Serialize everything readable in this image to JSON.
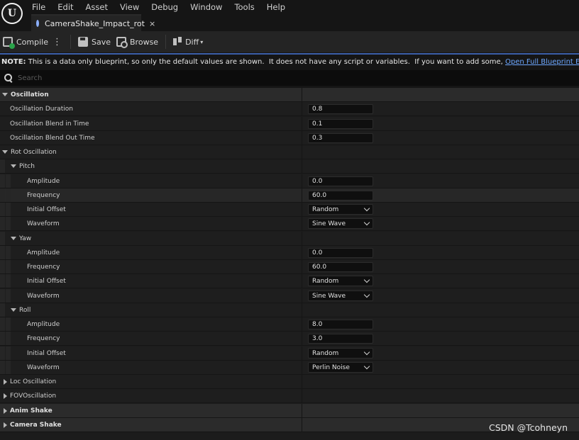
{
  "app": {
    "logo_letter": "U",
    "menu": [
      "File",
      "Edit",
      "Asset",
      "View",
      "Debug",
      "Window",
      "Tools",
      "Help"
    ],
    "tab_title": "CameraShake_Impact_rot",
    "tab_close": "×"
  },
  "toolbar": {
    "compile_label": "Compile",
    "more": "⋮",
    "save_label": "Save",
    "browse_label": "Browse",
    "diff_label": "Diff",
    "diff_caret": "▾"
  },
  "note": {
    "bold": "NOTE:",
    "text": " This is a data only blueprint, so only the default values are shown.  It does not have any script or variables.  If you want to add some, ",
    "link": "Open Full Blueprint Editor"
  },
  "search": {
    "placeholder": "Search"
  },
  "details": {
    "rows": [
      {
        "label": "Oscillation",
        "kind": "category",
        "arrow": "down",
        "depth": 0
      },
      {
        "label": "Oscillation Duration",
        "kind": "number",
        "value": "0.8",
        "depth": 1
      },
      {
        "label": "Oscillation Blend in Time",
        "kind": "number",
        "value": "0.1",
        "depth": 1
      },
      {
        "label": "Oscillation Blend Out Time",
        "kind": "number",
        "value": "0.3",
        "depth": 1
      },
      {
        "label": "Rot Oscillation",
        "kind": "group",
        "arrow": "down",
        "depth": 1
      },
      {
        "label": "Pitch",
        "kind": "group",
        "arrow": "down",
        "depth": 2
      },
      {
        "label": "Amplitude",
        "kind": "number",
        "value": "0.0",
        "depth": 3
      },
      {
        "label": "Frequency",
        "kind": "number",
        "value": "60.0",
        "depth": 3,
        "hover": true
      },
      {
        "label": "Initial Offset",
        "kind": "dropdown",
        "value": "Random",
        "depth": 3
      },
      {
        "label": "Waveform",
        "kind": "dropdown",
        "value": "Sine Wave",
        "depth": 3
      },
      {
        "label": "Yaw",
        "kind": "group",
        "arrow": "down",
        "depth": 2
      },
      {
        "label": "Amplitude",
        "kind": "number",
        "value": "0.0",
        "depth": 3
      },
      {
        "label": "Frequency",
        "kind": "number",
        "value": "60.0",
        "depth": 3
      },
      {
        "label": "Initial Offset",
        "kind": "dropdown",
        "value": "Random",
        "depth": 3
      },
      {
        "label": "Waveform",
        "kind": "dropdown",
        "value": "Sine Wave",
        "depth": 3
      },
      {
        "label": "Roll",
        "kind": "group",
        "arrow": "down",
        "depth": 2
      },
      {
        "label": "Amplitude",
        "kind": "number",
        "value": "8.0",
        "depth": 3
      },
      {
        "label": "Frequency",
        "kind": "number",
        "value": "3.0",
        "depth": 3
      },
      {
        "label": "Initial Offset",
        "kind": "dropdown",
        "value": "Random",
        "depth": 3
      },
      {
        "label": "Waveform",
        "kind": "dropdown",
        "value": "Perlin Noise",
        "depth": 3
      },
      {
        "label": "Loc Oscillation",
        "kind": "group",
        "arrow": "right",
        "depth": 1
      },
      {
        "label": "FOVOscillation",
        "kind": "group",
        "arrow": "right",
        "depth": 1
      },
      {
        "label": "Anim Shake",
        "kind": "category",
        "arrow": "right",
        "depth": 0
      },
      {
        "label": "Camera Shake",
        "kind": "category",
        "arrow": "right",
        "depth": 0
      }
    ]
  },
  "watermark": "CSDN @Tcohneyn",
  "colors": {
    "accent_link": "#6da7ff",
    "note_border": "#3b5ea8",
    "compile_ok": "#2aa34a"
  },
  "icons": [
    "unreal-logo-icon",
    "blueprint-icon",
    "compile-icon",
    "save-icon",
    "browse-icon",
    "diff-icon",
    "search-icon",
    "mouse-cursor-icon"
  ]
}
